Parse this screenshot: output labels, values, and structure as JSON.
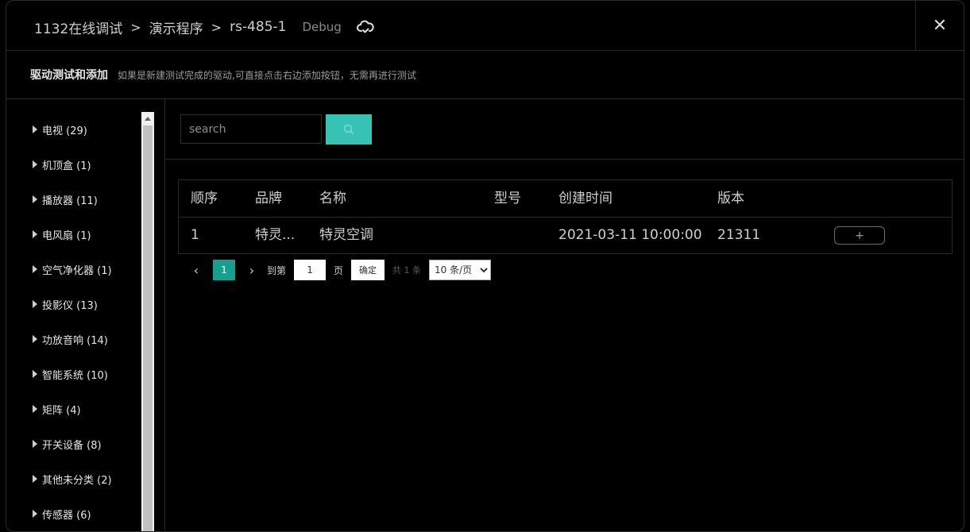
{
  "header": {
    "breadcrumbs": [
      "1132在线调试",
      "演示程序",
      "rs-485-1"
    ],
    "mode_tag": "Debug",
    "cloud_icon": "cloud-check-icon",
    "close_label": "✕"
  },
  "subheader": {
    "title": "驱动测试和添加",
    "hint": "如果是新建测试完成的驱动,可直接点击右边添加按钮，无需再进行测试"
  },
  "sidebar": {
    "items": [
      {
        "label": "电视 (29)"
      },
      {
        "label": "机顶盒 (1)"
      },
      {
        "label": "播放器 (11)"
      },
      {
        "label": "电风扇 (1)"
      },
      {
        "label": "空气净化器 (1)"
      },
      {
        "label": "投影仪 (13)"
      },
      {
        "label": "功放音响 (14)"
      },
      {
        "label": "智能系统 (10)"
      },
      {
        "label": "矩阵 (4)"
      },
      {
        "label": "开关设备 (8)"
      },
      {
        "label": "其他未分类 (2)"
      },
      {
        "label": "传感器 (6)"
      }
    ]
  },
  "search": {
    "placeholder": "search",
    "value": ""
  },
  "table": {
    "columns": [
      "顺序",
      "品牌",
      "名称",
      "型号",
      "创建时间",
      "版本"
    ],
    "rows": [
      {
        "order": "1",
        "brand": "特灵...",
        "name": "特灵空调",
        "model": "",
        "created": "2021-03-11 10:00:00",
        "version": "21311",
        "action": "+"
      }
    ]
  },
  "pagination": {
    "prev": "‹",
    "current": "1",
    "next": "›",
    "goto_label": "到第",
    "goto_value": "1",
    "page_label": "页",
    "confirm_label": "确定",
    "total": "共 1 条",
    "page_size": "10 条/页",
    "page_size_options": [
      "10 条/页"
    ]
  },
  "colors": {
    "accent": "#37c3b4",
    "pager_active": "#169e8e",
    "background": "#000000"
  }
}
